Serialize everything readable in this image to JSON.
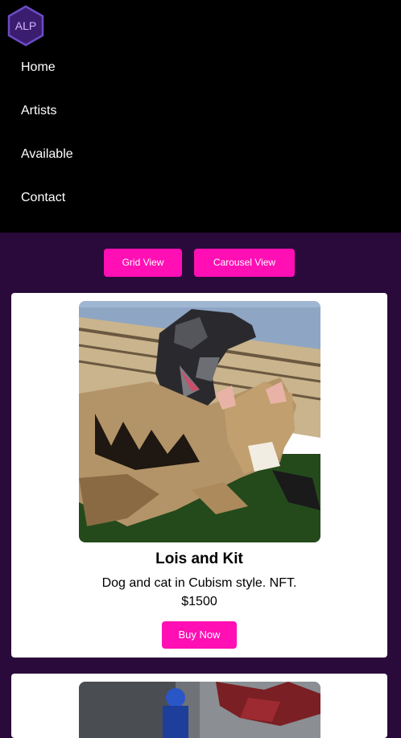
{
  "brand": {
    "logo_text": "ALP",
    "logo_icon": "hexagon-logo-icon"
  },
  "nav": {
    "items": [
      {
        "label": "Home"
      },
      {
        "label": "Artists"
      },
      {
        "label": "Available"
      },
      {
        "label": "Contact"
      }
    ]
  },
  "view_toggle": {
    "grid_label": "Grid View",
    "carousel_label": "Carousel View"
  },
  "cards": [
    {
      "title": "Lois and Kit",
      "description": "Dog and cat in Cubism style. NFT.",
      "price": "$1500",
      "buy_label": "Buy Now"
    }
  ],
  "colors": {
    "header_bg": "#000000",
    "page_bg": "#2a0a3a",
    "accent": "#ff0fb4",
    "logo_border": "#5b3aa8"
  }
}
